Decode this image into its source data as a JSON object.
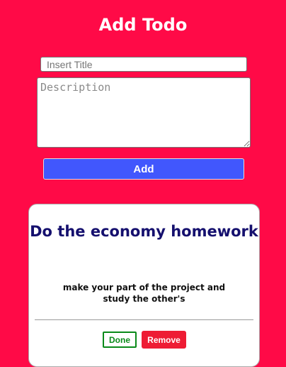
{
  "header": {
    "title": "Add Todo"
  },
  "form": {
    "title_placeholder": "Insert Title",
    "title_value": "",
    "description_placeholder": "Description",
    "description_value": "",
    "add_label": "Add"
  },
  "todos": [
    {
      "title": "Do the economy homework",
      "description": "make your part of the project and study the other's",
      "done_label": "Done",
      "remove_label": "Remove"
    }
  ],
  "colors": {
    "background": "#ff0a47",
    "add_button": "#4157fd",
    "todo_title": "#15106e",
    "done_button": "#0a8a1a",
    "remove_button": "#ee1c34"
  }
}
